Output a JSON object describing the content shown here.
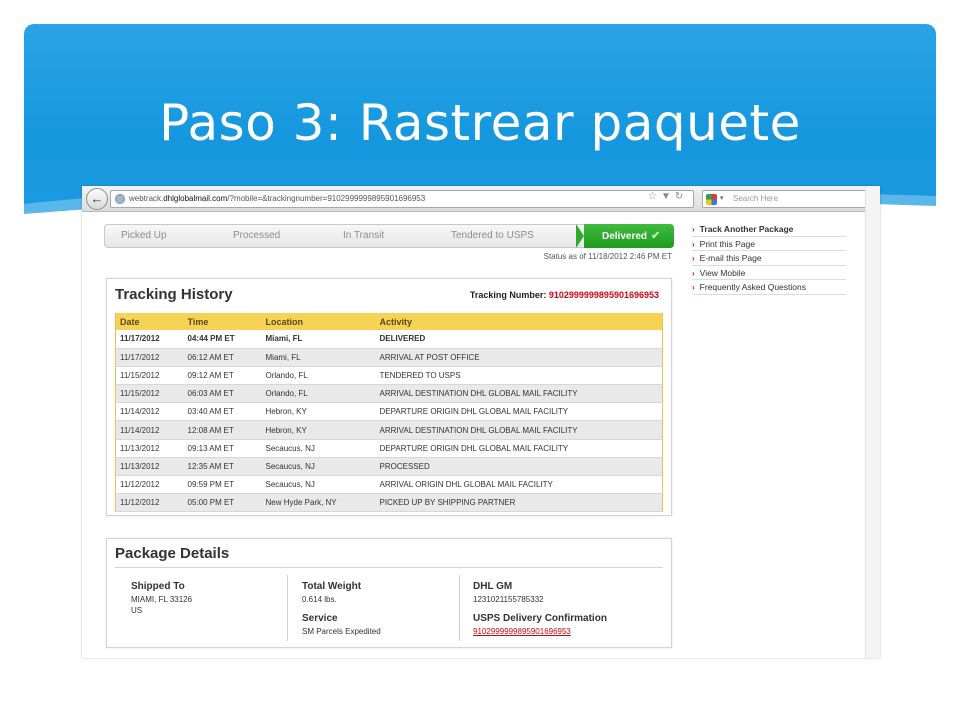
{
  "slide": {
    "title": "Paso 3: Rastrear paquete"
  },
  "browser": {
    "url_prefix": "webtrack.",
    "url_host": "dhlglobalmail.com",
    "url_rest": "/?mobile=&trackingnumber=9102999999895901696953",
    "search_placeholder": "Search Here"
  },
  "progress": {
    "steps": [
      "Picked Up",
      "Processed",
      "In Transit",
      "Tendered to USPS"
    ],
    "current": "Delivered",
    "status_as_of": "Status as of 11/18/2012 2:46 PM ET"
  },
  "tracking_history": {
    "title": "Tracking History",
    "number_label": "Tracking Number:",
    "number": "9102999999895901696953",
    "columns": [
      "Date",
      "Time",
      "Location",
      "Activity"
    ],
    "rows": [
      [
        "11/17/2012",
        "04:44 PM ET",
        "Miami, FL",
        "DELIVERED"
      ],
      [
        "11/17/2012",
        "06:12 AM ET",
        "Miami, FL",
        "ARRIVAL AT POST OFFICE"
      ],
      [
        "11/15/2012",
        "09:12 AM ET",
        "Orlando, FL",
        "TENDERED TO USPS"
      ],
      [
        "11/15/2012",
        "06:03 AM ET",
        "Orlando, FL",
        "ARRIVAL DESTINATION DHL GLOBAL MAIL FACILITY"
      ],
      [
        "11/14/2012",
        "03:40 AM ET",
        "Hebron, KY",
        "DEPARTURE ORIGIN DHL GLOBAL MAIL FACILITY"
      ],
      [
        "11/14/2012",
        "12:08 AM ET",
        "Hebron, KY",
        "ARRIVAL DESTINATION DHL GLOBAL MAIL FACILITY"
      ],
      [
        "11/13/2012",
        "09:13 AM ET",
        "Secaucus, NJ",
        "DEPARTURE ORIGIN DHL GLOBAL MAIL FACILITY"
      ],
      [
        "11/13/2012",
        "12:35 AM ET",
        "Secaucus, NJ",
        "PROCESSED"
      ],
      [
        "11/12/2012",
        "09:59 PM ET",
        "Secaucus, NJ",
        "ARRIVAL ORIGIN DHL GLOBAL MAIL FACILITY"
      ],
      [
        "11/12/2012",
        "05:00 PM ET",
        "New Hyde Park, NY",
        "PICKED UP BY SHIPPING PARTNER"
      ]
    ]
  },
  "package_details": {
    "title": "Package Details",
    "shipped_to_label": "Shipped To",
    "shipped_to_line1": "MIAMI, FL 33126",
    "shipped_to_line2": "US",
    "weight_label": "Total Weight",
    "weight_value": "0.614 lbs.",
    "service_label": "Service",
    "service_value": "SM Parcels Expedited",
    "dhl_gm_label": "DHL GM",
    "dhl_gm_value": "1231021155785332",
    "usps_label": "USPS Delivery Confirmation",
    "usps_value": "9102999999895901696953"
  },
  "sidebar": {
    "items": [
      "Track Another Package",
      "Print this Page",
      "E-mail this Page",
      "View Mobile",
      "Frequently Asked Questions"
    ]
  },
  "colors": {
    "slide_blue": "#1597de",
    "dhl_red": "#d40511",
    "table_header_yellow": "#f6d354",
    "delivered_green": "#2eaa2e"
  }
}
